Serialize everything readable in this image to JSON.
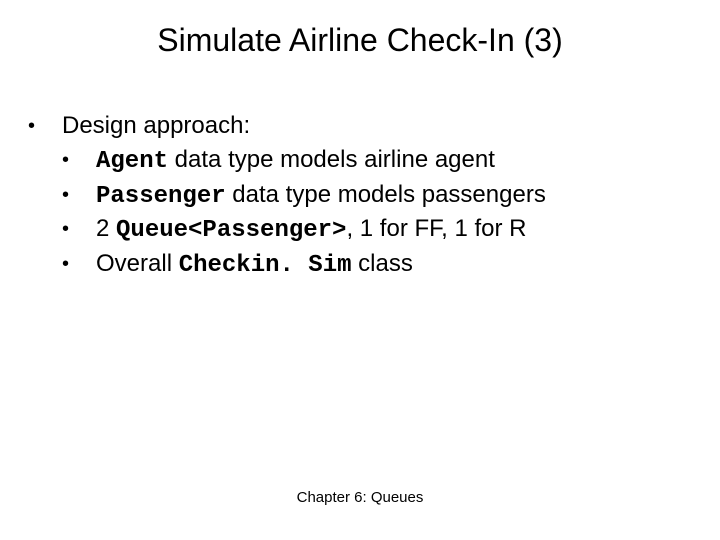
{
  "title": "Simulate Airline Check-In (3)",
  "body": {
    "heading": "Design approach:",
    "items": [
      {
        "code": "Agent",
        "before": "",
        "after": " data type models airline agent"
      },
      {
        "code": "Passenger",
        "before": "",
        "after": " data type models passengers"
      },
      {
        "code": "Queue<Passenger>",
        "before": "2 ",
        "after": ", 1 for FF, 1 for R"
      },
      {
        "code": "Checkin. Sim",
        "before": "Overall ",
        "after": " class"
      }
    ]
  },
  "footer": "Chapter 6: Queues",
  "bullet_char": "•"
}
